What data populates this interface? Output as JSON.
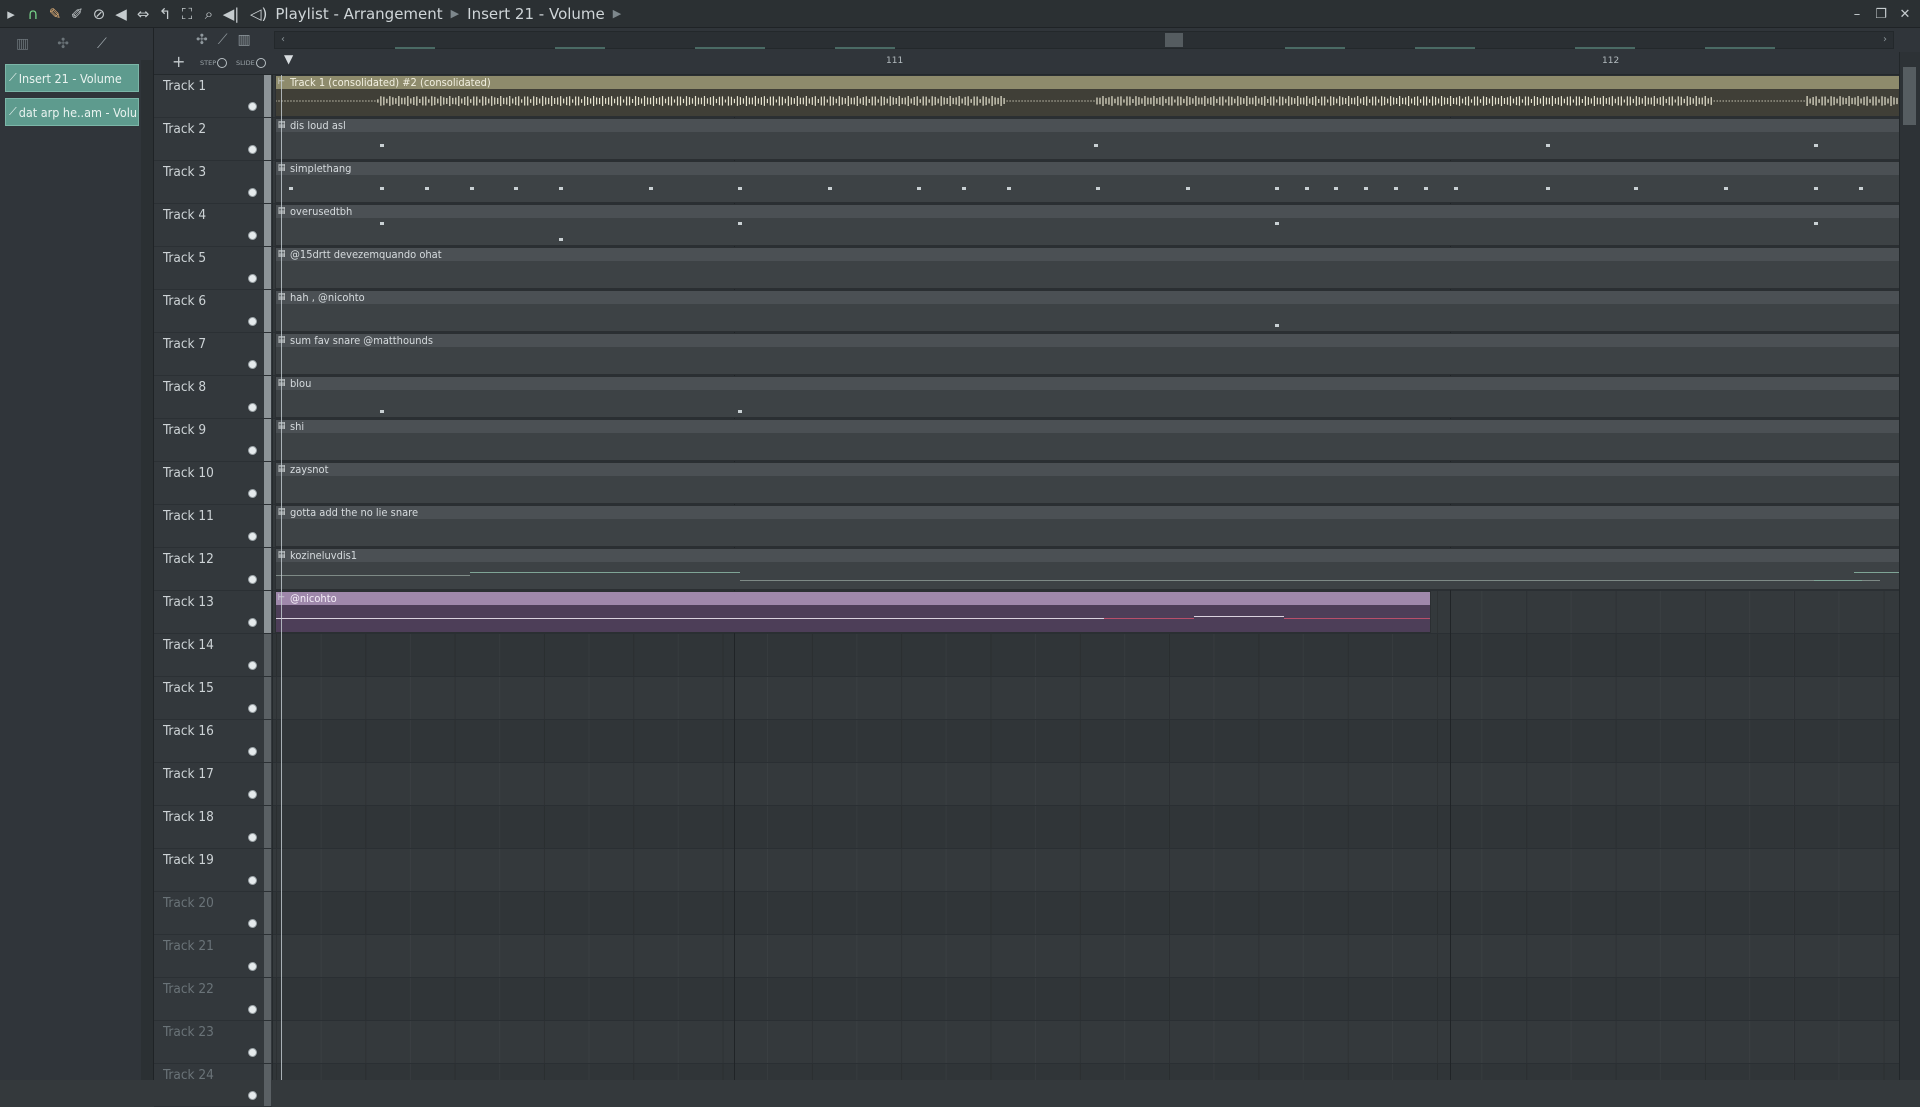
{
  "toolbar": {
    "icons": [
      "play-arrow-icon",
      "magnet-icon",
      "pencil-icon",
      "paint-icon",
      "delete-icon",
      "mute-icon",
      "slip-icon",
      "slice-icon",
      "select-icon",
      "zoom-icon",
      "playback-icon"
    ],
    "speaker_icon": "speaker-icon"
  },
  "title": {
    "part1": "Playlist - Arrangement",
    "part2": "Insert 21 - Volume"
  },
  "left_panel": {
    "items": [
      {
        "label": "Insert 21 - Volume"
      },
      {
        "label": "dat arp he..am - Volume"
      }
    ]
  },
  "timeline": {
    "bars": [
      "111",
      "112"
    ]
  },
  "header_controls": {
    "step": "STEP",
    "slide": "SLIDE",
    "add": "+"
  },
  "tracks": [
    {
      "name": "Track 1"
    },
    {
      "name": "Track 2"
    },
    {
      "name": "Track 3"
    },
    {
      "name": "Track 4"
    },
    {
      "name": "Track 5"
    },
    {
      "name": "Track 6"
    },
    {
      "name": "Track 7"
    },
    {
      "name": "Track 8"
    },
    {
      "name": "Track 9"
    },
    {
      "name": "Track 10"
    },
    {
      "name": "Track 11"
    },
    {
      "name": "Track 12"
    },
    {
      "name": "Track 13"
    },
    {
      "name": "Track 14"
    },
    {
      "name": "Track 15"
    },
    {
      "name": "Track 16"
    },
    {
      "name": "Track 17"
    },
    {
      "name": "Track 18"
    },
    {
      "name": "Track 19"
    },
    {
      "name": "Track 20"
    },
    {
      "name": "Track 21"
    },
    {
      "name": "Track 22"
    },
    {
      "name": "Track 23"
    },
    {
      "name": "Track 24"
    }
  ],
  "clips": [
    {
      "name": "Track 1 (consolidated) #2 (consolidated)",
      "type": "audio"
    },
    {
      "name": "dis loud asl",
      "type": "pattern"
    },
    {
      "name": "simplethang",
      "type": "pattern"
    },
    {
      "name": "overusedtbh",
      "type": "pattern"
    },
    {
      "name": "@15drtt devezemquando ohat",
      "type": "pattern"
    },
    {
      "name": "hah , @nicohto",
      "type": "pattern"
    },
    {
      "name": "sum fav snare @matthounds",
      "type": "pattern"
    },
    {
      "name": "blou",
      "type": "pattern"
    },
    {
      "name": "shi",
      "type": "pattern"
    },
    {
      "name": "zaysnot",
      "type": "pattern"
    },
    {
      "name": "gotta add the no lie snare",
      "type": "pattern"
    },
    {
      "name": "kozineluvdis1",
      "type": "pattern"
    },
    {
      "name": "@nicohto",
      "type": "automation"
    }
  ],
  "colors": {
    "accent": "#5e9b8e",
    "audio_clip": "#8e8b6c",
    "automation_clip": "#9f88ab",
    "background": "#34393c"
  }
}
